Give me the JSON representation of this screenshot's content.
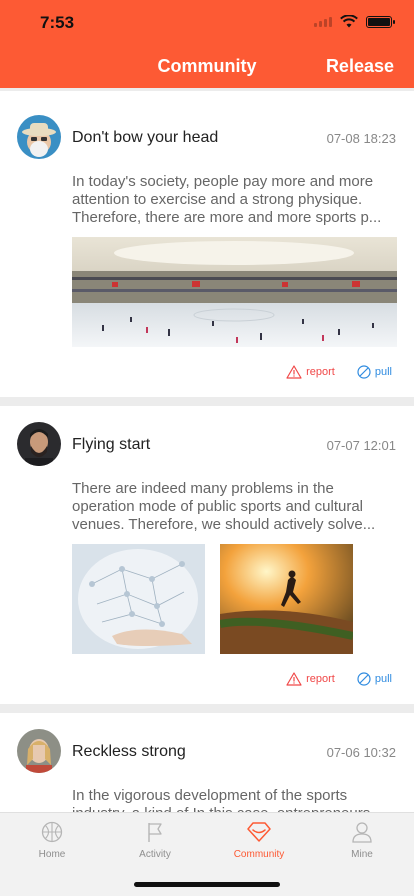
{
  "status": {
    "time": "7:53"
  },
  "nav": {
    "title": "Community",
    "release": "Release"
  },
  "posts": [
    {
      "title": "Don't bow your head",
      "time": "07-08 18:23",
      "body": "In today's society, people pay more and more attention to exercise and a strong physique. Therefore, there are more and more sports p...",
      "report": "report",
      "pull": "pull"
    },
    {
      "title": "Flying start",
      "time": "07-07 12:01",
      "body": "There are indeed many problems in the operation mode of public sports and cultural venues. Therefore, we should actively solve...",
      "report": "report",
      "pull": "pull"
    },
    {
      "title": "Reckless strong",
      "time": "07-06 10:32",
      "body": "In the vigorous development of the sports industry, a kind of In this case, entrepreneurs..."
    }
  ],
  "tabs": [
    {
      "label": "Home",
      "icon": "basketball-icon"
    },
    {
      "label": "Activity",
      "icon": "flag-icon"
    },
    {
      "label": "Community",
      "icon": "community-gem-icon"
    },
    {
      "label": "Mine",
      "icon": "user-icon"
    }
  ],
  "colors": {
    "accent": "#fd5a34",
    "report": "#f04848",
    "pull": "#2f8be0"
  }
}
